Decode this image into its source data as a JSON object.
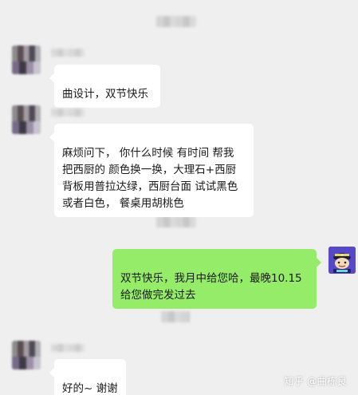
{
  "chat": {
    "messages": [
      {
        "sender": "them",
        "text": "曲设计，双节快乐"
      },
      {
        "sender": "them",
        "text": "麻烦问下， 你什么时候 有时间 帮我\n把西厨的 颜色换一换，大理石+西厨\n背板用普拉达绿，西厨台面 试试黑色\n或者白色， 餐桌用胡桃色"
      },
      {
        "sender": "me",
        "text": "双节快乐，我月中给您哈，最晚10.15\n给您做完发过去"
      },
      {
        "sender": "them",
        "text": "好的~ 谢谢"
      }
    ]
  },
  "watermark": "知乎 @曲栋良",
  "colors": {
    "background": "#efefef",
    "bubble_incoming": "#ffffff",
    "bubble_outgoing": "#95ec69"
  }
}
